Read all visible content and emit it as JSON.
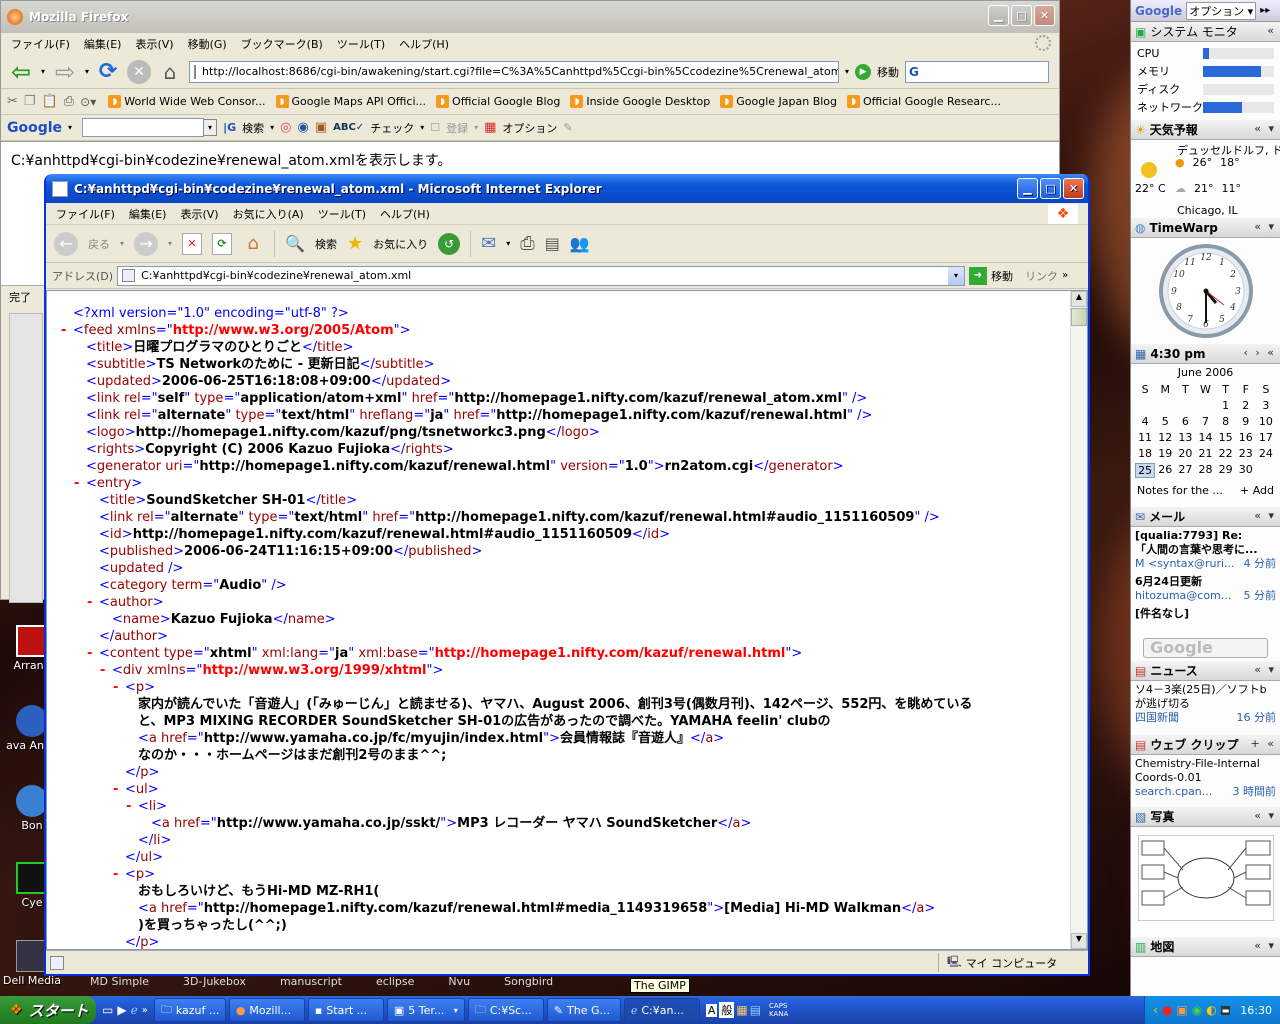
{
  "firefox": {
    "title": "Mozilla Firefox",
    "menu": [
      "ファイル(F)",
      "編集(E)",
      "表示(V)",
      "移動(G)",
      "ブックマーク(B)",
      "ツール(T)",
      "ヘルプ(H)"
    ],
    "url": "http://localhost:8686/cgi-bin/awakening/start.cgi?file=C%3A%5Canhttpd%5Ccgi-bin%5Ccodezine%5Crenewal_atom.xml",
    "go_label": "移動",
    "bookmarks": [
      "World Wide Web Consor...",
      "Google Maps API Offici...",
      "Official Google Blog",
      "Inside Google Desktop",
      "Google Japan Blog",
      "Official Google Researc..."
    ],
    "google_toolbar": {
      "logo": "Google",
      "search_label": "検索",
      "check_label": "チェック",
      "register_label": "登録",
      "options_label": "オプション"
    },
    "content_text": "C:¥anhttpd¥cgi-bin¥codezine¥renewal_atom.xmlを表示します。",
    "status": "完了"
  },
  "ie": {
    "title": "C:¥anhttpd¥cgi-bin¥codezine¥renewal_atom.xml - Microsoft Internet Explorer",
    "menu": [
      "ファイル(F)",
      "編集(E)",
      "表示(V)",
      "お気に入り(A)",
      "ツール(T)",
      "ヘルプ(H)"
    ],
    "back_label": "戻る",
    "search_label": "検索",
    "favorites_label": "お気に入り",
    "address_label": "アドレス(D)",
    "address": "C:¥anhttpd¥cgi-bin¥codezine¥renewal_atom.xml",
    "go_label": "移動",
    "links_label": "リンク",
    "status_zone": "マイ コンピュータ",
    "xml_lines": [
      {
        "i": 0,
        "m": "",
        "h": "<span class='t'>&lt;?xml version=\"1.0\" encoding=\"utf-8\" ?&gt;</span>"
      },
      {
        "i": 0,
        "m": "-",
        "h": "<span class='t'>&lt;</span><span class='a'>feed</span> <span class='a'>xmlns</span><span class='t'>=\"</span><span class='m'>http://www.w3.org/2005/Atom</span><span class='t'>\"&gt;</span>"
      },
      {
        "i": 1,
        "m": "",
        "h": "<span class='t'>&lt;</span><span class='a'>title</span><span class='t'>&gt;</span><span class='x'>日曜プログラマのひとりごと</span><span class='t'>&lt;/</span><span class='a'>title</span><span class='t'>&gt;</span>"
      },
      {
        "i": 1,
        "m": "",
        "h": "<span class='t'>&lt;</span><span class='a'>subtitle</span><span class='t'>&gt;</span><span class='x'>TS Networkのために - 更新日記</span><span class='t'>&lt;/</span><span class='a'>subtitle</span><span class='t'>&gt;</span>"
      },
      {
        "i": 1,
        "m": "",
        "h": "<span class='t'>&lt;</span><span class='a'>updated</span><span class='t'>&gt;</span><span class='x'>2006-06-25T16:18:08+09:00</span><span class='t'>&lt;/</span><span class='a'>updated</span><span class='t'>&gt;</span>"
      },
      {
        "i": 1,
        "m": "",
        "h": "<span class='t'>&lt;</span><span class='a'>link</span> <span class='a'>rel</span><span class='t'>=\"</span><span class='v'>self</span><span class='t'>\"</span> <span class='a'>type</span><span class='t'>=\"</span><span class='v'>application/atom+xml</span><span class='t'>\"</span> <span class='a'>href</span><span class='t'>=\"</span><span class='v'>http://homepage1.nifty.com/kazuf/renewal_atom.xml</span><span class='t'>\" /&gt;</span>"
      },
      {
        "i": 1,
        "m": "",
        "h": "<span class='t'>&lt;</span><span class='a'>link</span> <span class='a'>rel</span><span class='t'>=\"</span><span class='v'>alternate</span><span class='t'>\"</span> <span class='a'>type</span><span class='t'>=\"</span><span class='v'>text/html</span><span class='t'>\"</span> <span class='a'>hreflang</span><span class='t'>=\"</span><span class='v'>ja</span><span class='t'>\"</span> <span class='a'>href</span><span class='t'>=\"</span><span class='v'>http://homepage1.nifty.com/kazuf/renewal.html</span><span class='t'>\" /&gt;</span>"
      },
      {
        "i": 1,
        "m": "",
        "h": "<span class='t'>&lt;</span><span class='a'>logo</span><span class='t'>&gt;</span><span class='x'>http://homepage1.nifty.com/kazuf/png/tsnetworkc3.png</span><span class='t'>&lt;/</span><span class='a'>logo</span><span class='t'>&gt;</span>"
      },
      {
        "i": 1,
        "m": "",
        "h": "<span class='t'>&lt;</span><span class='a'>rights</span><span class='t'>&gt;</span><span class='x'>Copyright (C) 2006 Kazuo Fujioka</span><span class='t'>&lt;/</span><span class='a'>rights</span><span class='t'>&gt;</span>"
      },
      {
        "i": 1,
        "m": "",
        "h": "<span class='t'>&lt;</span><span class='a'>generator</span> <span class='a'>uri</span><span class='t'>=\"</span><span class='v'>http://homepage1.nifty.com/kazuf/renewal.html</span><span class='t'>\"</span> <span class='a'>version</span><span class='t'>=\"</span><span class='v'>1.0</span><span class='t'>\"&gt;</span><span class='x'>rn2atom.cgi</span><span class='t'>&lt;/</span><span class='a'>generator</span><span class='t'>&gt;</span>"
      },
      {
        "i": 1,
        "m": "-",
        "h": "<span class='t'>&lt;</span><span class='a'>entry</span><span class='t'>&gt;</span>"
      },
      {
        "i": 2,
        "m": "",
        "h": "<span class='t'>&lt;</span><span class='a'>title</span><span class='t'>&gt;</span><span class='x'>SoundSketcher SH-01</span><span class='t'>&lt;/</span><span class='a'>title</span><span class='t'>&gt;</span>"
      },
      {
        "i": 2,
        "m": "",
        "h": "<span class='t'>&lt;</span><span class='a'>link</span> <span class='a'>rel</span><span class='t'>=\"</span><span class='v'>alternate</span><span class='t'>\"</span> <span class='a'>type</span><span class='t'>=\"</span><span class='v'>text/html</span><span class='t'>\"</span> <span class='a'>href</span><span class='t'>=\"</span><span class='v'>http://homepage1.nifty.com/kazuf/renewal.html#audio_1151160509</span><span class='t'>\" /&gt;</span>"
      },
      {
        "i": 2,
        "m": "",
        "h": "<span class='t'>&lt;</span><span class='a'>id</span><span class='t'>&gt;</span><span class='x'>http://homepage1.nifty.com/kazuf/renewal.html#audio_1151160509</span><span class='t'>&lt;/</span><span class='a'>id</span><span class='t'>&gt;</span>"
      },
      {
        "i": 2,
        "m": "",
        "h": "<span class='t'>&lt;</span><span class='a'>published</span><span class='t'>&gt;</span><span class='x'>2006-06-24T11:16:15+09:00</span><span class='t'>&lt;/</span><span class='a'>published</span><span class='t'>&gt;</span>"
      },
      {
        "i": 2,
        "m": "",
        "h": "<span class='t'>&lt;</span><span class='a'>updated</span> <span class='t'>/&gt;</span>"
      },
      {
        "i": 2,
        "m": "",
        "h": "<span class='t'>&lt;</span><span class='a'>category</span> <span class='a'>term</span><span class='t'>=\"</span><span class='v'>Audio</span><span class='t'>\" /&gt;</span>"
      },
      {
        "i": 2,
        "m": "-",
        "h": "<span class='t'>&lt;</span><span class='a'>author</span><span class='t'>&gt;</span>"
      },
      {
        "i": 3,
        "m": "",
        "h": "<span class='t'>&lt;</span><span class='a'>name</span><span class='t'>&gt;</span><span class='x'>Kazuo Fujioka</span><span class='t'>&lt;/</span><span class='a'>name</span><span class='t'>&gt;</span>"
      },
      {
        "i": 2,
        "m": "",
        "h": "<span class='t'>&lt;/</span><span class='a'>author</span><span class='t'>&gt;</span>"
      },
      {
        "i": 2,
        "m": "-",
        "h": "<span class='t'>&lt;</span><span class='a'>content</span> <span class='a'>type</span><span class='t'>=\"</span><span class='v'>xhtml</span><span class='t'>\"</span> <span class='a'>xml:lang</span><span class='t'>=\"</span><span class='v'>ja</span><span class='t'>\"</span> <span class='a'>xml:base</span><span class='t'>=\"</span><span class='m'>http://homepage1.nifty.com/kazuf/renewal.html</span><span class='t'>\"&gt;</span>"
      },
      {
        "i": 3,
        "m": "-",
        "h": "<span class='t'>&lt;</span><span class='a'>div</span> <span class='a'>xmlns</span><span class='t'>=\"</span><span class='m'>http://www.w3.org/1999/xhtml</span><span class='t'>\"&gt;</span>"
      },
      {
        "i": 4,
        "m": "-",
        "h": "<span class='t'>&lt;</span><span class='a'>p</span><span class='t'>&gt;</span>"
      },
      {
        "i": 5,
        "m": "",
        "h": "<span class='x'>家内が読んでいた「音遊人」(「みゅーじん」と読ませる)、ヤマハ、August 2006、創刊3号(偶数月刊)、142ページ、552円、を眺めている</span>"
      },
      {
        "i": 5,
        "m": "",
        "h": "<span class='x'>と、MP3 MIXING RECORDER SoundSketcher SH-01の広告があったので調べた。YAMAHA feelin' clubの</span>"
      },
      {
        "i": 5,
        "m": "",
        "h": "<span class='t'>&lt;</span><span class='a'>a</span> <span class='a'>href</span><span class='t'>=\"</span><span class='v'>http://www.yamaha.co.jp/fc/myujin/index.html</span><span class='t'>\"&gt;</span><span class='x'>会員情報誌『音遊人』</span><span class='t'>&lt;/</span><span class='a'>a</span><span class='t'>&gt;</span>"
      },
      {
        "i": 5,
        "m": "",
        "h": "<span class='x'>なのか・・・ホームページはまだ創刊2号のまま^^;</span>"
      },
      {
        "i": 4,
        "m": "",
        "h": "<span class='t'>&lt;/</span><span class='a'>p</span><span class='t'>&gt;</span>"
      },
      {
        "i": 4,
        "m": "-",
        "h": "<span class='t'>&lt;</span><span class='a'>ul</span><span class='t'>&gt;</span>"
      },
      {
        "i": 5,
        "m": "-",
        "h": "<span class='t'>&lt;</span><span class='a'>li</span><span class='t'>&gt;</span>"
      },
      {
        "i": 6,
        "m": "",
        "h": "<span class='t'>&lt;</span><span class='a'>a</span> <span class='a'>href</span><span class='t'>=\"</span><span class='v'>http://www.yamaha.co.jp/sskt/</span><span class='t'>\"&gt;</span><span class='x'>MP3 レコーダー ヤマハ SoundSketcher</span><span class='t'>&lt;/</span><span class='a'>a</span><span class='t'>&gt;</span>"
      },
      {
        "i": 5,
        "m": "",
        "h": "<span class='t'>&lt;/</span><span class='a'>li</span><span class='t'>&gt;</span>"
      },
      {
        "i": 4,
        "m": "",
        "h": "<span class='t'>&lt;/</span><span class='a'>ul</span><span class='t'>&gt;</span>"
      },
      {
        "i": 4,
        "m": "-",
        "h": "<span class='t'>&lt;</span><span class='a'>p</span><span class='t'>&gt;</span>"
      },
      {
        "i": 5,
        "m": "",
        "h": "<span class='x'>おもしろいけど、もうHi-MD MZ-RH1(</span>"
      },
      {
        "i": 5,
        "m": "",
        "h": "<span class='t'>&lt;</span><span class='a'>a</span> <span class='a'>href</span><span class='t'>=\"</span><span class='v'>http://homepage1.nifty.com/kazuf/renewal.html#media_1149319658</span><span class='t'>\"&gt;</span><span class='x'>[Media] Hi-MD Walkman</span><span class='t'>&lt;/</span><span class='a'>a</span><span class='t'>&gt;</span>"
      },
      {
        "i": 5,
        "m": "",
        "h": "<span class='x'>)を買っちゃったし(^^;)</span>"
      },
      {
        "i": 4,
        "m": "",
        "h": "<span class='t'>&lt;/</span><span class='a'>p</span><span class='t'>&gt;</span>"
      }
    ]
  },
  "sidebar": {
    "google_logo": "Google",
    "options_label": "オプション",
    "sysmon_title": "システム モニタ",
    "sysmon_rows": [
      {
        "label": "CPU",
        "level": 0.08
      },
      {
        "label": "メモリ",
        "level": 0.82
      },
      {
        "label": "ディスク",
        "level": 0.0
      },
      {
        "label": "ネットワーク",
        "level": 0.55
      }
    ],
    "weather_title": "天気予報",
    "weather_city1": "デュッセルドルフ, ド",
    "weather_current": "22° C",
    "weather_rows": [
      [
        "26°",
        "18°"
      ],
      [
        "21°",
        "11°"
      ]
    ],
    "weather_city2": "Chicago, IL",
    "timewarp_title": "TimeWarp",
    "clock_time": "4:30 pm",
    "calendar_month": "June 2006",
    "calendar_days": [
      "S",
      "M",
      "T",
      "W",
      "T",
      "F",
      "S"
    ],
    "calendar_weeks": [
      [
        "",
        "",
        "",
        "",
        "1",
        "2",
        "3"
      ],
      [
        "4",
        "5",
        "6",
        "7",
        "8",
        "9",
        "10"
      ],
      [
        "11",
        "12",
        "13",
        "14",
        "15",
        "16",
        "17"
      ],
      [
        "18",
        "19",
        "20",
        "21",
        "22",
        "23",
        "24"
      ],
      [
        "25",
        "26",
        "27",
        "28",
        "29",
        "30",
        ""
      ]
    ],
    "calendar_today": "25",
    "notes_label": "Notes for the ...",
    "add_label": "+ Add",
    "mail_title": "メール",
    "mail_items": [
      {
        "subject": "[qualia:7793] Re:",
        "subject2": "「人間の言葉や思考に...",
        "from": "M <syntax@ruri...",
        "time": "4 分前"
      },
      {
        "subject": "6月24日更新",
        "subject2": "",
        "from": "hitozuma@com...",
        "time": "5 分前"
      },
      {
        "subject": "[件名なし]",
        "subject2": "",
        "from": "",
        "time": ""
      }
    ],
    "news_title": "ニュース",
    "news_items": [
      {
        "text": "ソ4－3楽(25日)／ソフトbが逃げ切る",
        "source": "四国新聞",
        "time": "16 分前"
      }
    ],
    "webclip_title": "ウェブ クリップ",
    "webclip_items": [
      {
        "text": "Chemistry-File-Internal Coords-0.01",
        "source": "search.cpan...",
        "time": "3 時間前"
      }
    ],
    "photo_title": "写真",
    "map_title": "地図"
  },
  "desktop_icons": [
    "Arrang",
    "ava Antiv",
    "Bon",
    "Cye",
    "Dell Media"
  ],
  "bottom_labels": [
    "MD Simple",
    "3D-Jukebox",
    "manuscript",
    "eclipse",
    "Nvu",
    "Songbird"
  ],
  "taskbar": {
    "start_label": "スタート",
    "tasks": [
      "kazuf ...",
      "Mozill...",
      "Start ...",
      "5 Ter...",
      "C:¥Sc...",
      "The G...",
      "C:¥an..."
    ],
    "tooltip": "The GIMP",
    "tray_caps": "CAPS",
    "tray_kana": "KANA",
    "clock": "16:30",
    "ime_label": "般"
  }
}
